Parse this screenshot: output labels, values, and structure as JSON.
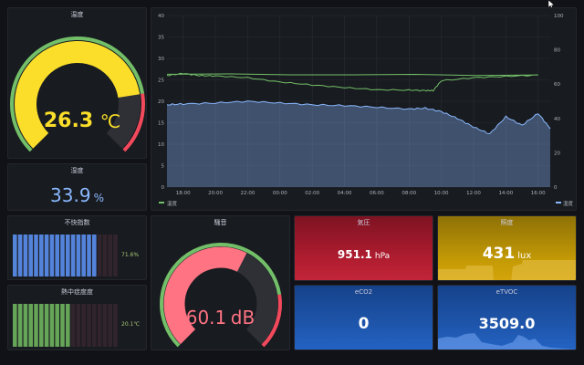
{
  "colors": {
    "panel_bg": "#181b1f",
    "temp_yellow": "#fade2a",
    "green": "#73bf69",
    "red": "#f2495c",
    "blue_text": "#8ab8ff",
    "noise_red": "#ff7383",
    "pressure_bg": "#a1182a",
    "light_bg": "#c59b05",
    "co2_bg": "#1e56a8",
    "blue_series": "#8ab8ff"
  },
  "temperature": {
    "title": "温度",
    "value": "26.3",
    "unit": "℃",
    "fraction": 0.8
  },
  "humidity": {
    "title": "湿度",
    "value": "33.9",
    "unit": "%"
  },
  "discomfort": {
    "title": "不快指数",
    "value_label": "71.6%",
    "filled_bars": 16,
    "total_bars": 20,
    "color": "#5b8ff0"
  },
  "heatstroke": {
    "title": "熱中症度度",
    "value_label": "20.1℃",
    "filled_bars": 11,
    "total_bars": 20,
    "color": "#6fb55e"
  },
  "noise": {
    "title": "騒音",
    "value": "60.1",
    "unit": "dB",
    "fraction": 0.6
  },
  "pressure": {
    "title": "気圧",
    "value": "951.1",
    "unit": "hPa"
  },
  "illuminance": {
    "title": "照度",
    "value": "431",
    "unit": "lux"
  },
  "eco2": {
    "title": "eCO2",
    "value": "0",
    "unit": ""
  },
  "etvoc": {
    "title": "eTVOC",
    "value": "3509.0",
    "unit": ""
  },
  "chart_data": {
    "type": "line",
    "x_ticks": [
      "18:00",
      "20:00",
      "22:00",
      "00:00",
      "02:00",
      "04:00",
      "06:00",
      "08:00",
      "10:00",
      "12:00",
      "14:00",
      "16:00"
    ],
    "y_left_ticks": [
      "0",
      "5",
      "10",
      "15",
      "20",
      "25",
      "30",
      "35",
      "40"
    ],
    "y_right_ticks": [
      "0",
      "20",
      "40",
      "60",
      "80",
      "100"
    ],
    "ylim_left": [
      0,
      40
    ],
    "ylim_right": [
      0,
      100
    ],
    "grid": true,
    "legend_position": "bottom",
    "series": [
      {
        "name": "温度",
        "axis": "left",
        "color": "#73bf69",
        "x": [
          "17:00",
          "18:00",
          "19:00",
          "20:00",
          "22:00",
          "00:00",
          "02:00",
          "04:00",
          "06:00",
          "08:00",
          "09:00",
          "09:30",
          "10:00",
          "12:00",
          "14:00",
          "16:00",
          "17:00"
        ],
        "y": [
          26,
          26.5,
          26,
          25.9,
          25.5,
          24.5,
          23.8,
          23.2,
          22.7,
          22.6,
          22.5,
          22.5,
          24.8,
          25.5,
          25.8,
          26.1,
          26.3
        ]
      },
      {
        "name": "湿度",
        "axis": "right",
        "color": "#8ab8ff",
        "x": [
          "17:00",
          "18:00",
          "20:00",
          "22:00",
          "00:00",
          "02:00",
          "04:00",
          "06:00",
          "08:00",
          "09:00",
          "10:00",
          "11:00",
          "12:00",
          "13:00",
          "14:00",
          "15:00",
          "16:00",
          "16:45"
        ],
        "y": [
          48,
          48.5,
          49,
          50,
          49,
          48,
          47.5,
          46.5,
          45.5,
          46,
          44,
          40,
          35,
          31,
          41,
          36,
          43,
          34
        ]
      }
    ]
  }
}
